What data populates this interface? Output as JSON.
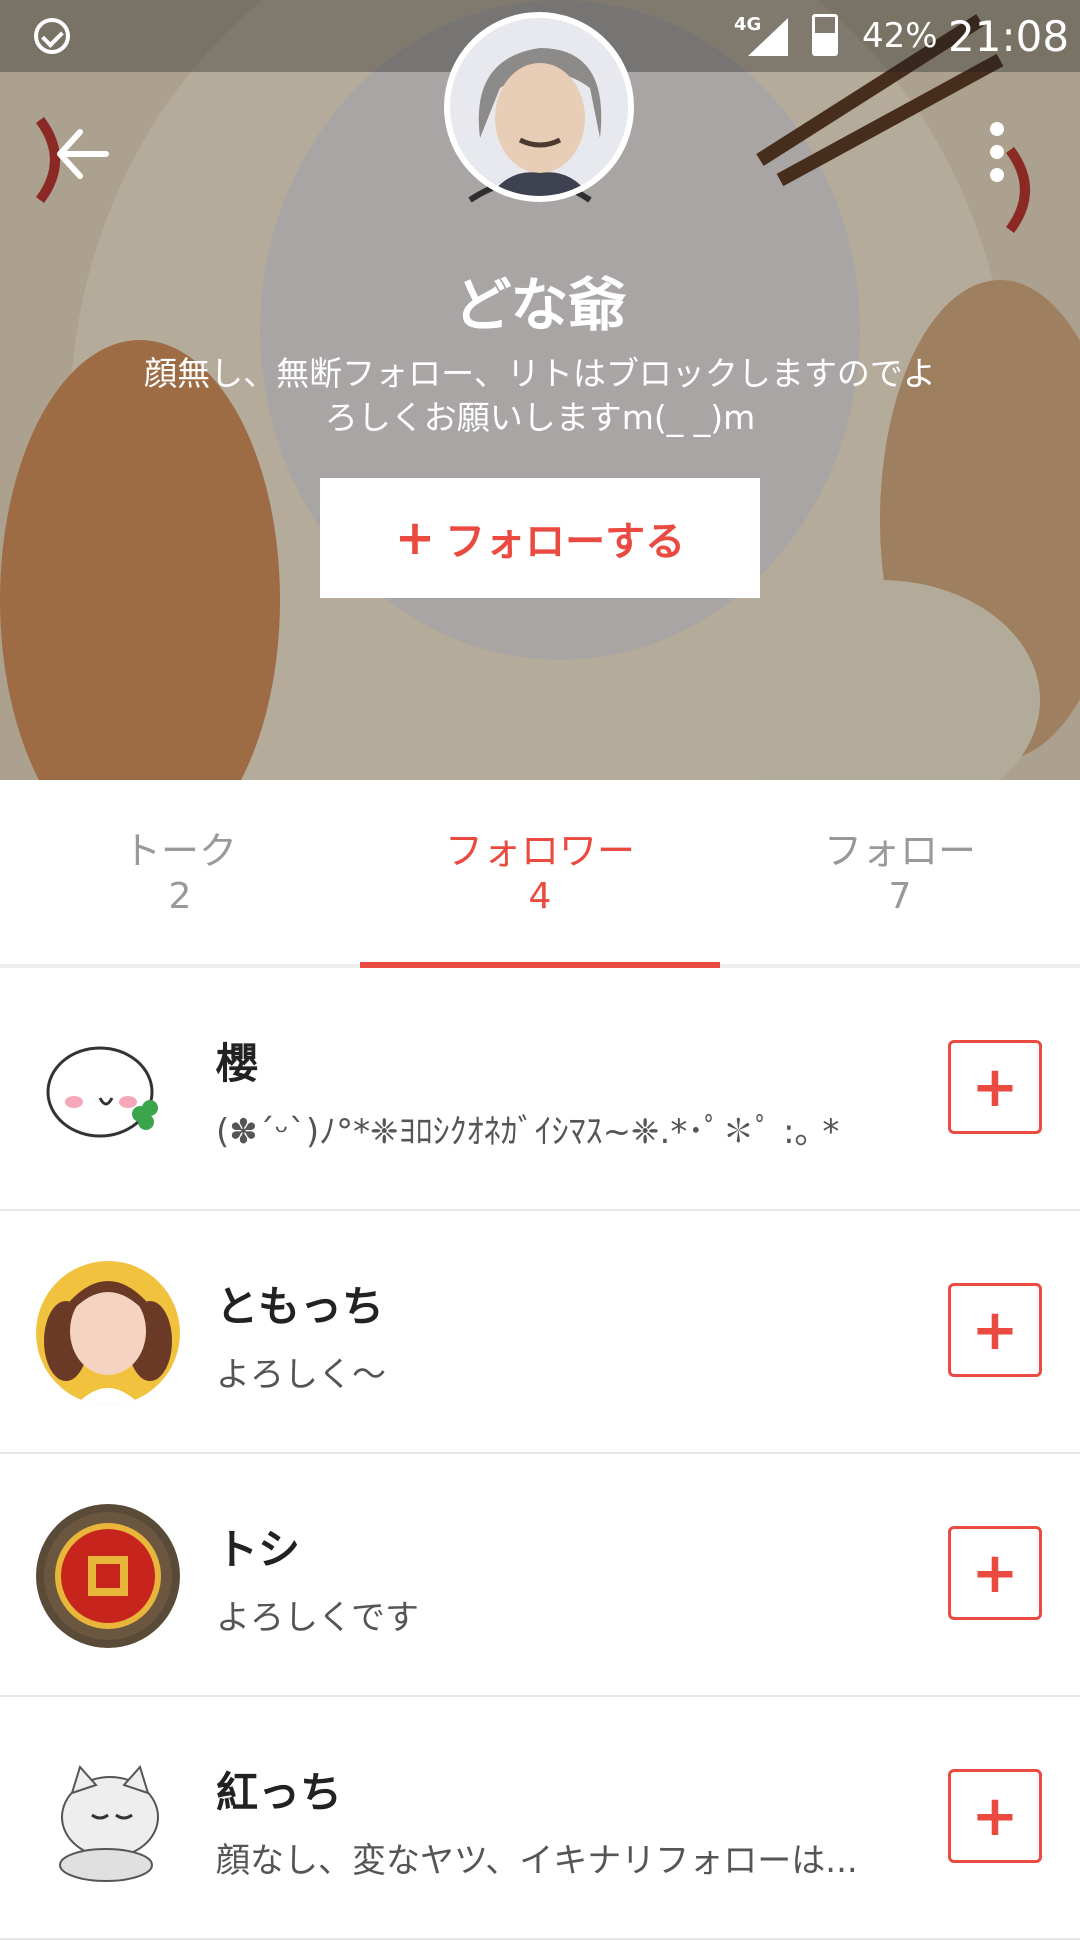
{
  "status_bar": {
    "network": "4G",
    "battery": "42%",
    "time": "21:08"
  },
  "header": {
    "name": "どな爺",
    "bio": "顔無し、無断フォロー、リトはブロックしますのでよろしくお願いしますm(_ _)m",
    "follow_button": {
      "icon": "+",
      "label": "フォローする"
    }
  },
  "tabs": [
    {
      "label": "トーク",
      "count": "2"
    },
    {
      "label": "フォロワー",
      "count": "4"
    },
    {
      "label": "フォロー",
      "count": "7"
    }
  ],
  "followers": [
    {
      "name": "櫻",
      "message": "(✽´ᵕ`)ﾉ°*❈ﾖﾛｼｸｵﾈｶﾞｲｼﾏｽ~❈.*･ﾟ✽ﾟ :｡ *",
      "add_icon": "+"
    },
    {
      "name": "ともっち",
      "message": "よろしく〜",
      "add_icon": "+"
    },
    {
      "name": "トシ",
      "message": "よろしくです",
      "add_icon": "+"
    },
    {
      "name": "紅っち",
      "message": "顔なし、変なヤツ、イキナリフォローは...",
      "add_icon": "+"
    }
  ],
  "colors": {
    "accent": "#ea4a3f",
    "tab_inactive": "#999999",
    "divider": "#e6e6e6"
  },
  "icons": {
    "back": "back-arrow-icon",
    "more": "more-vertical-icon",
    "add": "plus-icon"
  }
}
